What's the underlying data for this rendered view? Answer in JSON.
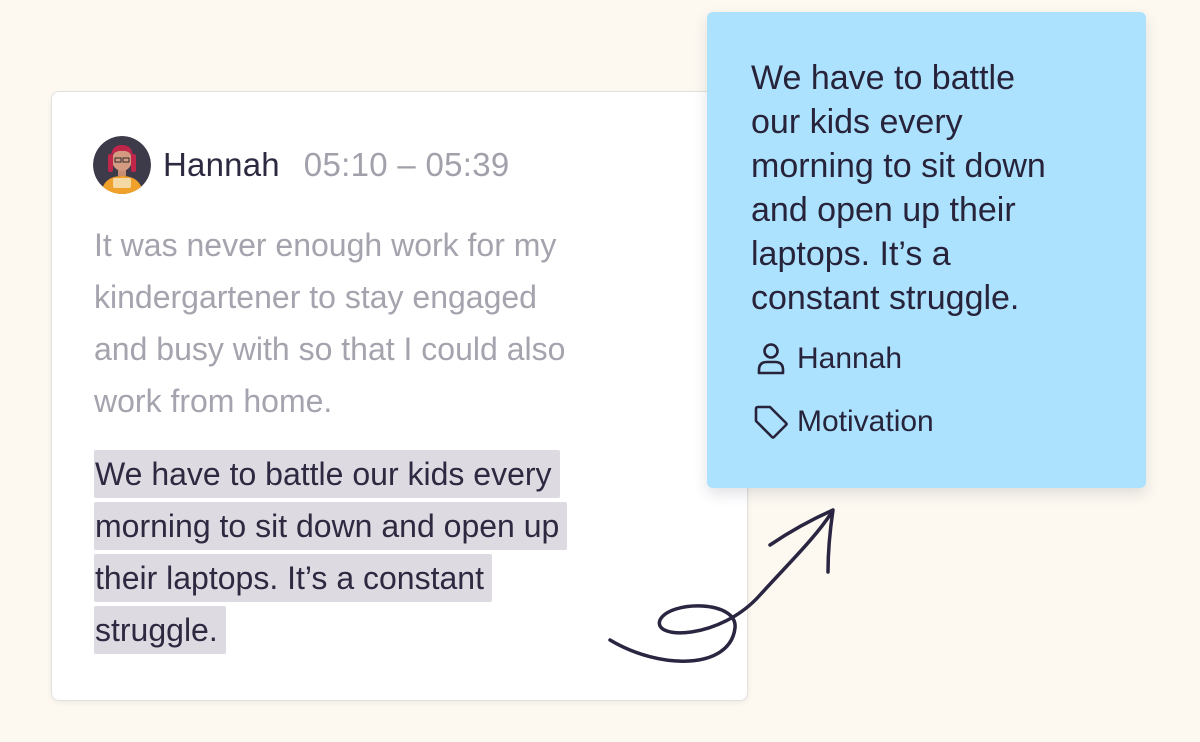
{
  "transcript": {
    "speaker": "Hannah",
    "timestamp": "05:10 – 05:39",
    "muted_lines": [
      "It was never enough work for my",
      "kindergartener to stay engaged",
      "and busy with so that I could also",
      "work from home."
    ],
    "highlighted_lines": [
      "We have to battle our kids every",
      "morning to sit down and open up",
      "their laptops. It’s a constant",
      "struggle."
    ]
  },
  "sticky_note": {
    "quote_lines": [
      "We have to battle",
      "our kids every",
      "morning to sit down",
      "and open up their",
      "laptops. It’s a",
      "constant struggle."
    ],
    "author": "Hannah",
    "tag": "Motivation",
    "author_icon": "person-icon",
    "tag_icon": "tag-icon"
  },
  "colors": {
    "background": "#fdf9f1",
    "note_background": "#ade2fe",
    "highlight": "#dddae1",
    "text_dark": "#2e2940",
    "text_muted": "#a5a3ad"
  }
}
